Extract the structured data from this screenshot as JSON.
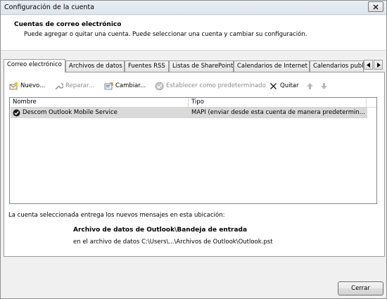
{
  "window": {
    "title": "Configuración de la cuenta"
  },
  "header": {
    "title": "Cuentas de correo electrónico",
    "description": "Puede agregar o quitar una cuenta. Puede seleccionar una cuenta y cambiar su configuración."
  },
  "tabs": [
    {
      "label": "Correo electrónico",
      "active": true
    },
    {
      "label": "Archivos de datos",
      "active": false
    },
    {
      "label": "Fuentes RSS",
      "active": false
    },
    {
      "label": "Listas de SharePoint",
      "active": false
    },
    {
      "label": "Calendarios de Internet",
      "active": false
    },
    {
      "label": "Calendarios publi",
      "active": false
    }
  ],
  "toolbar": {
    "new_label": "Nuevo...",
    "repair_label": "Reparar...",
    "change_label": "Cambiar...",
    "set_default_label": "Establecer como predeterminado",
    "remove_label": "Quitar"
  },
  "account_list": {
    "columns": [
      "Nombre",
      "Tipo"
    ],
    "rows": [
      {
        "name": "Descom Outlook Mobile Service",
        "type": "MAPI (enviar desde esta cuenta de manera predetermin..."
      }
    ]
  },
  "delivery": {
    "info": "La cuenta seleccionada entrega los nuevos mensajes en esta ubicación:",
    "store_name": "Archivo de datos de Outlook\\Bandeja de entrada",
    "store_path": "en el archivo de datos C:\\Users\\...\\Archivos de Outlook\\Outlook.pst"
  },
  "footer": {
    "close_label": "Cerrar"
  }
}
